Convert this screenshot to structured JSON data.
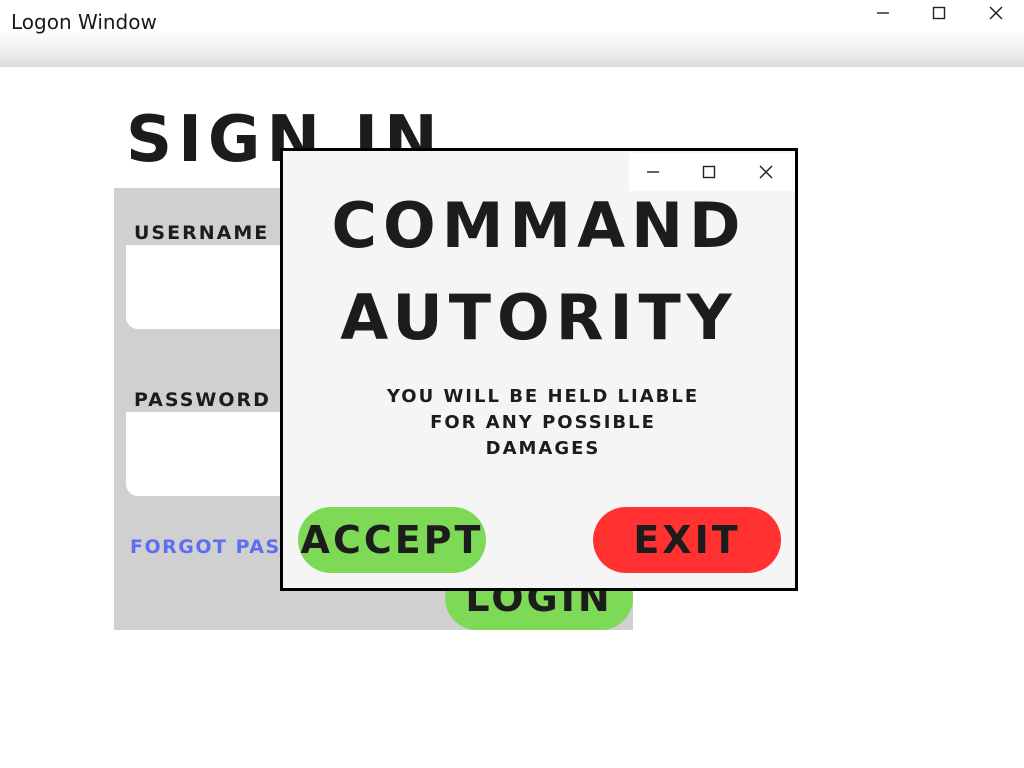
{
  "window": {
    "title": "Logon Window",
    "controls": [
      "minimize-icon",
      "maximize-icon",
      "close-icon"
    ]
  },
  "login": {
    "heading": "SIGN IN",
    "username_label": "USERNAME",
    "username_value": "",
    "password_label": "PASSWORD",
    "password_value": "",
    "forgot_link": "FORGOT PASSWORD?",
    "login_button": "LOGIN"
  },
  "dialog": {
    "title_line1": "COMMAND",
    "title_line2": "AUTORITY",
    "message": "YOU WILL BE HELD LIABLE FOR ANY POSSIBLE DAMAGES",
    "accept_button": "ACCEPT",
    "exit_button": "EXIT",
    "controls": [
      "minimize-icon",
      "maximize-icon",
      "close-icon"
    ]
  },
  "colors": {
    "panel": "#d0d0d0",
    "accept": "#7ed957",
    "exit": "#ff3131",
    "link": "#5b6ef5",
    "text": "#1c1c1c"
  }
}
